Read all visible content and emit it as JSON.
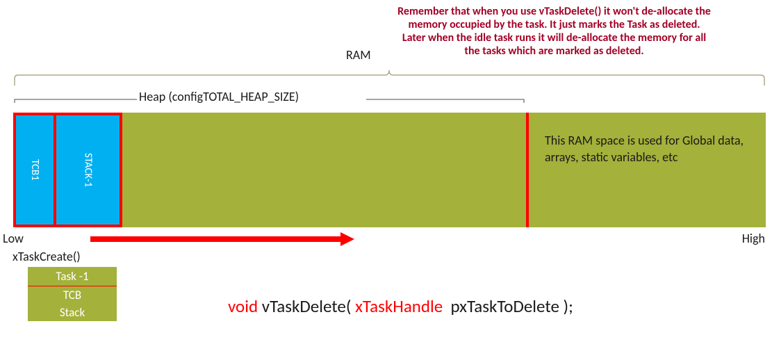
{
  "labels": {
    "ram": "RAM",
    "heap": "Heap (configTOTAL_HEAP_SIZE)",
    "low": "Low",
    "high": "High",
    "xtaskcreate": "xTaskCreate()"
  },
  "warning": "Remember that when you use vTaskDelete() it won't de-allocate the memory occupied by the task. It just marks the Task as deleted. Later when the idle task runs it will de-allocate the memory for all the tasks which are marked as deleted.",
  "blocks": {
    "tcb": "TCB1",
    "stack": "STACK-1"
  },
  "global_text": "This RAM space is used for Global data, arrays, static variables, etc",
  "task_box": {
    "title": "Task -1",
    "row1": "TCB",
    "row2": "Stack"
  },
  "code": {
    "kw_void": "void",
    "fn": " vTaskDelete( ",
    "type": "xTaskHandle",
    "param": "  pxTaskToDelete );"
  }
}
